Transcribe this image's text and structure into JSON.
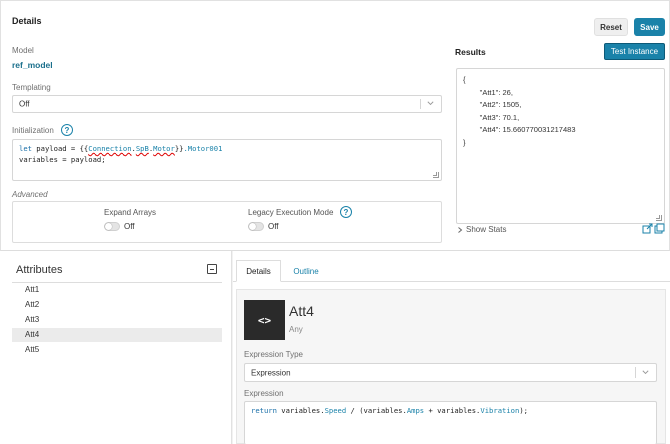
{
  "details": {
    "title": "Details",
    "reset_label": "Reset",
    "save_label": "Save",
    "model_label": "Model",
    "model_name": "ref_model",
    "templating_label": "Templating",
    "templating_value": "Off",
    "initialization_label": "Initialization",
    "initialization_code": {
      "line1_kw": "let",
      "line1_a": " payload = {{",
      "line1_b": "Connection",
      "line1_c": ".",
      "line1_d": "SpB",
      "line1_e": ".",
      "line1_f": "Motor",
      "line1_g": "}}",
      "line1_h": ".Motor001",
      "line2": "variables = payload;"
    },
    "advanced_label": "Advanced",
    "expand_arrays_label": "Expand Arrays",
    "expand_arrays_state": "Off",
    "legacy_mode_label": "Legacy Execution Mode",
    "legacy_mode_state": "Off"
  },
  "results": {
    "title": "Results",
    "test_button_label": "Test Instance",
    "json_text": "{\n        \"Att1\": 26,\n        \"Att2\": 1505,\n        \"Att3\": 70.1,\n        \"Att4\": 15.660770031217483\n}",
    "show_stats_label": "Show Stats"
  },
  "attributes": {
    "title": "Attributes",
    "items": [
      "Att1",
      "Att2",
      "Att3",
      "Att4",
      "Att5"
    ],
    "selected": "Att4"
  },
  "tabs": {
    "details_label": "Details",
    "outline_label": "Outline"
  },
  "attribute_detail": {
    "icon_glyph": "<>",
    "name": "Att4",
    "type": "Any",
    "expression_type_label": "Expression Type",
    "expression_type_value": "Expression",
    "expression_label": "Expression",
    "expression_code": {
      "kw": "return",
      "a": " variables.",
      "b": "Speed",
      "c": " / (variables.",
      "d": "Amps",
      "e": " + variables.",
      "f": "Vibration",
      "g": ");"
    }
  },
  "colors": {
    "accent": "#1a82a9",
    "link": "#1a6f8c",
    "selected_row": "#ebebeb",
    "icon_bg": "#2a2a2a"
  },
  "icons": [
    "help-icon",
    "chevron-down-icon",
    "open-external-icon",
    "copy-icon",
    "chevron-right-icon",
    "collapse-icon",
    "code-icon"
  ]
}
